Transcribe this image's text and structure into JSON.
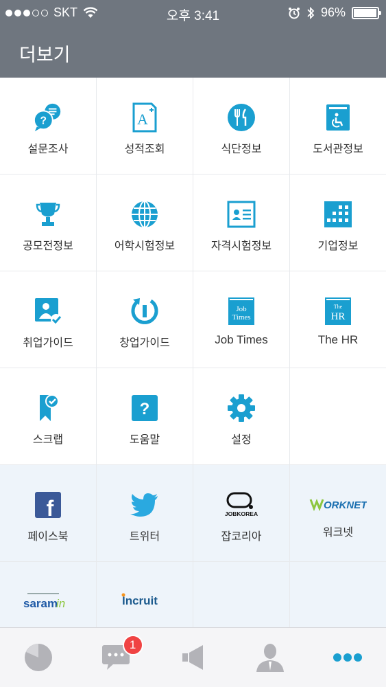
{
  "status": {
    "carrier": "SKT",
    "time": "오후 3:41",
    "battery": "96%",
    "battery_level": 0.96
  },
  "header": {
    "title": "더보기"
  },
  "menu": [
    {
      "label": "설문조사",
      "icon": "survey-chat-icon",
      "name": "menu-item-survey"
    },
    {
      "label": "성적조회",
      "icon": "grade-a-plus-icon",
      "name": "menu-item-grades"
    },
    {
      "label": "식단정보",
      "icon": "fork-knife-icon",
      "name": "menu-item-meals"
    },
    {
      "label": "도서관정보",
      "icon": "library-book-icon",
      "name": "menu-item-library"
    },
    {
      "label": "공모전정보",
      "icon": "trophy-icon",
      "name": "menu-item-contest"
    },
    {
      "label": "어학시험정보",
      "icon": "globe-icon",
      "name": "menu-item-language-test"
    },
    {
      "label": "자격시험정보",
      "icon": "id-card-icon",
      "name": "menu-item-certificate-test"
    },
    {
      "label": "기업정보",
      "icon": "building-icon",
      "name": "menu-item-company"
    },
    {
      "label": "취업가이드",
      "icon": "person-check-icon",
      "name": "menu-item-job-guide"
    },
    {
      "label": "창업가이드",
      "icon": "startup-power-icon",
      "name": "menu-item-startup-guide"
    },
    {
      "label": "Job Times",
      "icon": "job-times-icon",
      "name": "menu-item-job-times",
      "badge": "Job Times"
    },
    {
      "label": "The HR",
      "icon": "the-hr-icon",
      "name": "menu-item-the-hr",
      "badge_top": "The",
      "badge_main": "HR"
    },
    {
      "label": "스크랩",
      "icon": "bookmark-check-icon",
      "name": "menu-item-scrap"
    },
    {
      "label": "도움말",
      "icon": "question-icon",
      "name": "menu-item-help"
    },
    {
      "label": "설정",
      "icon": "gear-icon",
      "name": "menu-item-settings"
    }
  ],
  "external": [
    {
      "label": "페이스북",
      "icon": "facebook-icon",
      "name": "link-facebook",
      "logo_text": "f"
    },
    {
      "label": "트위터",
      "icon": "twitter-icon",
      "name": "link-twitter"
    },
    {
      "label": "잡코리아",
      "icon": "jobkorea-logo-icon",
      "name": "link-jobkorea",
      "logo_text": "JOBKOREA"
    },
    {
      "label": "워크넷",
      "icon": "worknet-logo-icon",
      "name": "link-worknet",
      "logo_text": "ORKNET"
    },
    {
      "label": "사람인",
      "icon": "saramin-logo-icon",
      "name": "link-saramin",
      "logo_text": "saram",
      "logo_text2": "in"
    },
    {
      "label": "인크루트",
      "icon": "incruit-logo-icon",
      "name": "link-incruit",
      "logo_text": "Incruit"
    }
  ],
  "tabbar": {
    "badge_count": "1"
  },
  "colors": {
    "accent": "#1a9fd0",
    "header": "#6f767f",
    "tab_active": "#1a9fd0",
    "tab_inactive": "#b3b3b8",
    "badge": "#f04343"
  }
}
